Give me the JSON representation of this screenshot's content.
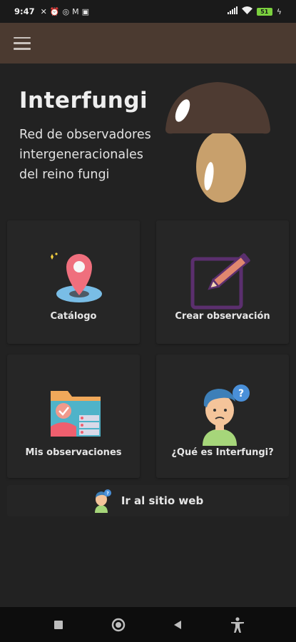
{
  "status_bar": {
    "time": "9:47",
    "battery": "51",
    "left_icons": [
      "mute-icon",
      "alarm-icon",
      "whatsapp-icon",
      "gmail-icon",
      "twitch-icon"
    ],
    "right_icons": [
      "signal-icon",
      "wifi-icon",
      "battery-icon",
      "charging-icon"
    ]
  },
  "app_bar": {
    "menu_icon": "hamburger-menu-icon"
  },
  "hero": {
    "title": "Interfungi",
    "subtitle_lines": [
      "Red de observadores",
      "intergeneracionales",
      "del reino fungi"
    ]
  },
  "cards": [
    {
      "label": "Catálogo",
      "icon": "map-pin-icon"
    },
    {
      "label": "Crear observación",
      "icon": "edit-note-icon"
    },
    {
      "label": "Mis observaciones",
      "icon": "folder-observations-icon"
    },
    {
      "label": "¿Qué es Interfungi?",
      "icon": "confused-person-icon"
    }
  ],
  "web_link": {
    "label": "Ir al sitio web",
    "icon": "person-question-icon"
  },
  "nav_bar": {
    "buttons": [
      "recents-button",
      "home-button",
      "back-button",
      "accessibility-button"
    ]
  },
  "colors": {
    "background": "#222222",
    "app_bar": "#4b3a30",
    "mushroom_cap": "#4e3b32",
    "mushroom_stem": "#c8a06c",
    "pencil": "#e0876f",
    "edit_frame": "#5b2f6e"
  }
}
